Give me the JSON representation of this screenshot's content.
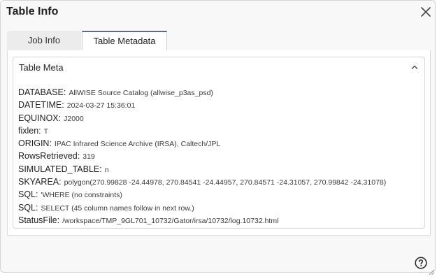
{
  "dialog": {
    "title": "Table Info"
  },
  "tabs": [
    {
      "label": "Job Info",
      "active": false
    },
    {
      "label": "Table Metadata",
      "active": true
    }
  ],
  "panel": {
    "title": "Table Meta",
    "expanded": true
  },
  "meta": [
    {
      "key": "DATABASE:",
      "value": "AllWISE Source Catalog (allwise_p3as_psd)"
    },
    {
      "key": "DATETIME:",
      "value": "2024-03-27 15:36:01"
    },
    {
      "key": "EQUINOX:",
      "value": "J2000"
    },
    {
      "key": "fixlen:",
      "value": "T"
    },
    {
      "key": "ORIGIN:",
      "value": "IPAC Infrared Science Archive (IRSA), Caltech/JPL"
    },
    {
      "key": "RowsRetrieved:",
      "value": "319"
    },
    {
      "key": "SIMULATED_TABLE:",
      "value": "n"
    },
    {
      "key": "SKYAREA:",
      "value": "polygon(270.99828 -24.44978, 270.84541 -24.44957, 270.84571 -24.31057, 270.99842 -24.31078)"
    },
    {
      "key": "SQL:",
      "value": "'WHERE (no constraints)"
    },
    {
      "key": "SQL:",
      "value": "SELECT (45 column names follow in next row.)"
    },
    {
      "key": "StatusFile:",
      "value": "/workspace/TMP_9GL701_10732/Gator/irsa/10732/log.10732.html"
    }
  ],
  "icons": {
    "close": "close-icon",
    "collapse": "chevron-up-icon",
    "help": "help-icon",
    "resize": "resize-grip-icon"
  }
}
